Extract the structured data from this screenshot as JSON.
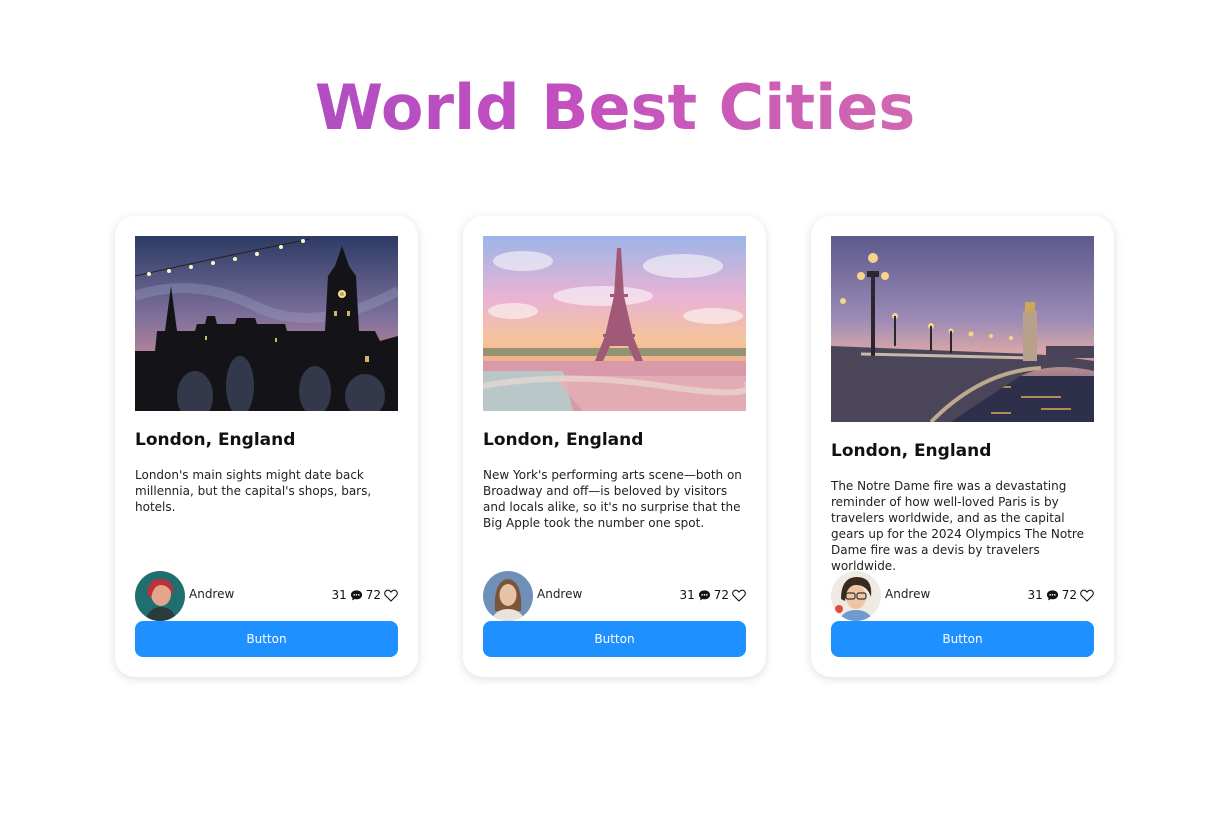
{
  "header": {
    "title": "World Best Cities"
  },
  "cards": [
    {
      "title": "London, England",
      "description": "London's main sights might date back millennia, but the capital's shops, bars, hotels.",
      "author": "Andrew",
      "comments": "31",
      "likes": "72",
      "button_label": "Button"
    },
    {
      "title": "London, England",
      "description": "New York's performing arts scene—both on Broadway and off—is beloved by visitors and locals alike, so it's no surprise that the Big Apple took the number one spot.",
      "author": "Andrew",
      "comments": "31",
      "likes": "72",
      "button_label": "Button"
    },
    {
      "title": "London, England",
      "description": "The Notre Dame fire was a devastating reminder of how well-loved Paris is by travelers worldwide, and as the capital gears up for the 2024 Olympics The Notre Dame fire was a devis by travelers worldwide.",
      "author": "Andrew",
      "comments": "31",
      "likes": "72",
      "button_label": "Button"
    }
  ],
  "colors": {
    "button": "#1e90ff",
    "title_gradient_start": "#9a4cc6",
    "title_gradient_end": "#e07ea2"
  },
  "icons": {
    "comment": "comment-icon",
    "like": "heart-icon"
  }
}
